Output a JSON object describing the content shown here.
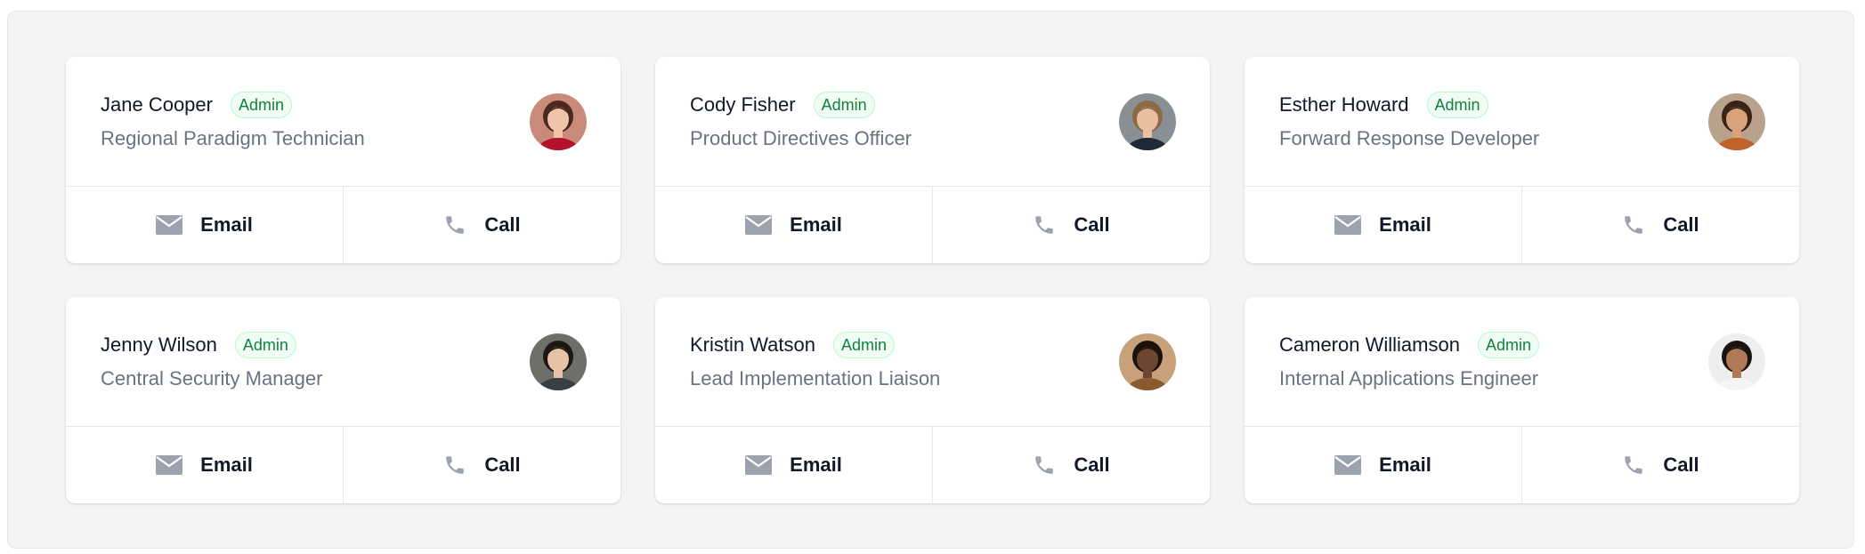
{
  "people": [
    {
      "name": "Jane Cooper",
      "role": "Admin",
      "title": "Regional Paradigm Technician",
      "email_label": "Email",
      "call_label": "Call",
      "avatar_colors": {
        "bg": "#c98a7a",
        "hair": "#4a2a1f",
        "skin": "#f0c4a8",
        "shirt": "#b3122a"
      }
    },
    {
      "name": "Cody Fisher",
      "role": "Admin",
      "title": "Product Directives Officer",
      "email_label": "Email",
      "call_label": "Call",
      "avatar_colors": {
        "bg": "#8a8f94",
        "hair": "#8b6a45",
        "skin": "#e8c0a0",
        "shirt": "#1f2937"
      }
    },
    {
      "name": "Esther Howard",
      "role": "Admin",
      "title": "Forward Response Developer",
      "email_label": "Email",
      "call_label": "Call",
      "avatar_colors": {
        "bg": "#b9a28c",
        "hair": "#3a2416",
        "skin": "#d9a27c",
        "shirt": "#c0632a"
      }
    },
    {
      "name": "Jenny Wilson",
      "role": "Admin",
      "title": "Central Security Manager",
      "email_label": "Email",
      "call_label": "Call",
      "avatar_colors": {
        "bg": "#6f6f6a",
        "hair": "#1c1712",
        "skin": "#e6c3a6",
        "shirt": "#3a3f45"
      }
    },
    {
      "name": "Kristin Watson",
      "role": "Admin",
      "title": "Lead Implementation Liaison",
      "email_label": "Email",
      "call_label": "Call",
      "avatar_colors": {
        "bg": "#c8a07a",
        "hair": "#1b120c",
        "skin": "#6e4630",
        "shirt": "#8a5a2f"
      }
    },
    {
      "name": "Cameron Williamson",
      "role": "Admin",
      "title": "Internal Applications Engineer",
      "email_label": "Email",
      "call_label": "Call",
      "avatar_colors": {
        "bg": "#eeeeee",
        "hair": "#1a1410",
        "skin": "#b07a58",
        "shirt": "#f4f4f4"
      }
    }
  ],
  "colors": {
    "panel_bg": "#f3f4f6",
    "badge_text": "#15803d",
    "badge_bg": "#f0fdf4",
    "icon_gray": "#9ca3af"
  },
  "icons": {
    "email": "envelope-icon",
    "call": "phone-icon"
  }
}
